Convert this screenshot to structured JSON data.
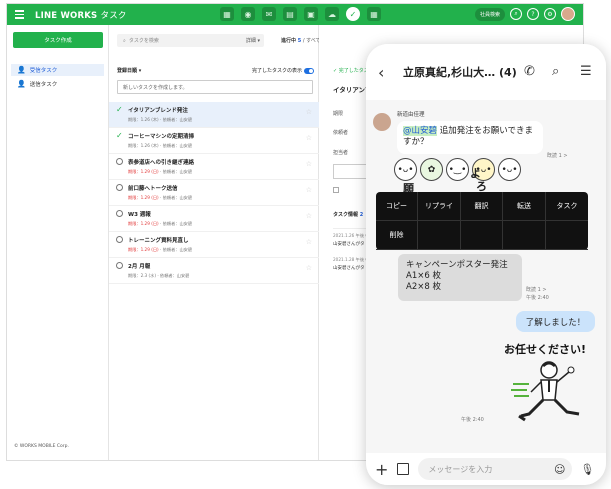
{
  "app": {
    "brand": "LINE WORKS",
    "title": "タスク",
    "search_pill": "社員検索",
    "copyright": "© WORKS MOBILE Corp."
  },
  "sidebar": {
    "create_label": "タスク作成",
    "items": [
      {
        "label": "受信タスク"
      },
      {
        "label": "送信タスク"
      }
    ]
  },
  "list": {
    "search_placeholder": "タスクを検索",
    "search_detail": "詳細 ▾",
    "tab_active_label": "進行中",
    "tab_active_count": "5",
    "tab_all": "すべて 7",
    "sort_label": "登録日順 ▾",
    "show_done_label": "完了したタスクの表示",
    "new_task_placeholder": "新しいタスクを作成します。",
    "rows": [
      {
        "title": "イタリアンブレンド発注",
        "due": "期限：1.26 (木)",
        "requester": "依頼者：山安碧",
        "done": true,
        "selected": true
      },
      {
        "title": "コーヒーマシンの定期清掃",
        "due": "期限：1.26 (木)",
        "requester": "依頼者：山安碧",
        "done": true
      },
      {
        "title": "表参道店への引き継ぎ連絡",
        "due": "期限：1.29 (日)",
        "requester": "依頼者：山安碧",
        "done": false,
        "due_red": true
      },
      {
        "title": "前口藤へトーク送信",
        "due": "期限：1.29 (日)",
        "requester": "依頼者：山安碧",
        "done": false,
        "due_red": true
      },
      {
        "title": "W3 週報",
        "due": "期限：1.29 (日)",
        "requester": "依頼者：山安碧",
        "done": false,
        "due_red": true
      },
      {
        "title": "トレーニング資料見直し",
        "due": "期限：1.29 (日)",
        "requester": "依頼者：山安碧",
        "done": false,
        "due_red": true
      },
      {
        "title": "2月 月報",
        "due": "期限：2.3 (水)",
        "requester": "依頼者：山安碧",
        "done": false
      }
    ]
  },
  "detail": {
    "status": "✓ 完了したタス",
    "title": "イタリアンブ",
    "label_due": "期限",
    "label_requester": "依頼者",
    "label_assignee": "担当者",
    "info_label": "タスク情報",
    "info_count": "2",
    "log1_date": "2021.1.26 午後 C",
    "log1_text": "山安碧さんがタ",
    "log2_date": "2021.1.28 午後 C",
    "log2_text": "山安碧さんがタ"
  },
  "phone": {
    "chat_title": "立原真紀,杉山大… (4)",
    "sender": "新道由佳理",
    "msg1_mention": "@山安碧",
    "msg1_text": " 追加発注をお願いできますか？",
    "sticker_text_a": "よ",
    "sticker_text_b": "ろ",
    "sticker_text_c": "願",
    "menu": [
      "コピー",
      "リプライ",
      "翻訳",
      "転送",
      "タスク",
      "削除"
    ],
    "msg2_lines": [
      "キャンペーンポスター発注",
      "A1×6 枚",
      "A2×8 枚"
    ],
    "msg2_read": "既読 1 >",
    "msg2_time": "午後 2:40",
    "msg3_text": "了解しました！",
    "top_read": "既読 1 >",
    "sticker2_text": "お任せください!",
    "time2": "午後 2:40",
    "input_placeholder": "メッセージを入力"
  },
  "colors": {
    "brand_green": "#22b14c",
    "accent_blue": "#1e5bd6",
    "due_red": "#e23b3b"
  }
}
